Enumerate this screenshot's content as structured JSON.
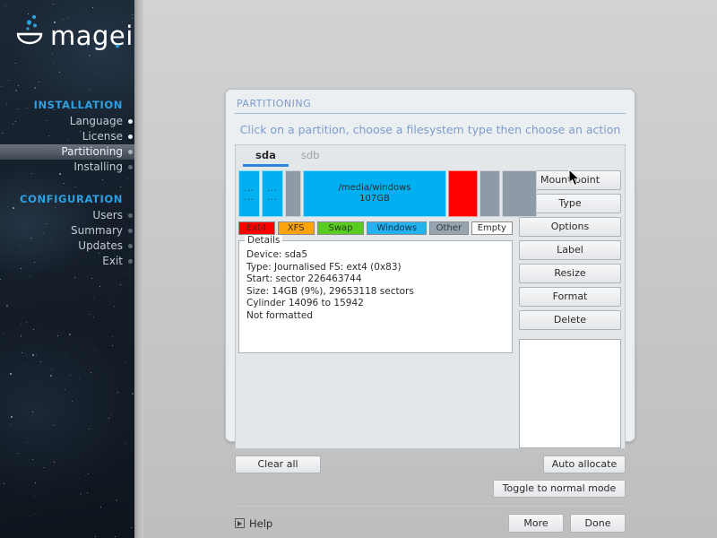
{
  "sidebar": {
    "logo_text": "mageia",
    "sections": [
      {
        "heading": "INSTALLATION",
        "items": [
          {
            "label": "Language",
            "state": "done"
          },
          {
            "label": "License",
            "state": "done"
          },
          {
            "label": "Partitioning",
            "state": "active"
          },
          {
            "label": "Installing",
            "state": "pending"
          }
        ]
      },
      {
        "heading": "CONFIGURATION",
        "items": [
          {
            "label": "Users",
            "state": "pending"
          },
          {
            "label": "Summary",
            "state": "pending"
          },
          {
            "label": "Updates",
            "state": "pending"
          },
          {
            "label": "Exit",
            "state": "pending"
          }
        ]
      }
    ]
  },
  "dialog": {
    "title": "PARTITIONING",
    "instruction": "Click on a partition, choose a filesystem type then choose an action",
    "tabs": [
      {
        "label": "sda",
        "active": true
      },
      {
        "label": "sdb",
        "active": false
      }
    ],
    "partitions": [
      {
        "label": "...\n...",
        "type": "Windows",
        "color": "#00b0f0",
        "width": 24
      },
      {
        "label": "...\n...",
        "type": "Windows",
        "color": "#00b0f0",
        "width": 24
      },
      {
        "label": "",
        "type": "Other",
        "color": "#8e9aa6",
        "width": 18
      },
      {
        "label": "/media/windows",
        "sublabel": "107GB",
        "type": "Windows",
        "color": "#00b0f0",
        "width": 160
      },
      {
        "label": "",
        "type": "Ext4",
        "color": "#fe0000",
        "width": 33
      },
      {
        "label": "",
        "type": "Other",
        "color": "#8e9aa6",
        "width": 23
      },
      {
        "label": "",
        "type": "Other",
        "color": "#8e9aa6",
        "width": 39
      }
    ],
    "legend": [
      {
        "label": "Ext4",
        "color": "#fe0000",
        "text_color": "#5a2020",
        "width": 44
      },
      {
        "label": "XFS",
        "color": "#fca310",
        "text_color": "#3a2a05",
        "width": 44
      },
      {
        "label": "Swap",
        "color": "#59cc1f",
        "text_color": "#1d3a0a",
        "width": 57
      },
      {
        "label": "Windows",
        "color": "#22b2f0",
        "text_color": "#0c3247",
        "width": 72
      },
      {
        "label": "Other",
        "color": "#97a3ae",
        "text_color": "#2e3841",
        "width": 47
      },
      {
        "label": "Empty",
        "color": "#ffffff",
        "text_color": "#2b2b2b",
        "width": 50
      }
    ],
    "details": {
      "legend_label": "Details",
      "lines": [
        "Device: sda5",
        "Type: Journalised FS: ext4 (0x83)",
        "Start: sector 226463744",
        "Size: 14GB (9%), 29653118 sectors",
        "Cylinder 14096 to 15942",
        "Not formatted"
      ]
    },
    "action_buttons": [
      "Mount point",
      "Type",
      "Options",
      "Label",
      "Resize",
      "Format",
      "Delete"
    ],
    "clear_all_label": "Clear all",
    "auto_allocate_label": "Auto allocate",
    "toggle_mode_label": "Toggle to normal mode",
    "help_label": "Help",
    "more_label": "More",
    "done_label": "Done"
  },
  "colors": {
    "accent_blue": "#2e86de",
    "heading_blue": "#2f9fe0",
    "title_blue": "#7d9ccd"
  }
}
